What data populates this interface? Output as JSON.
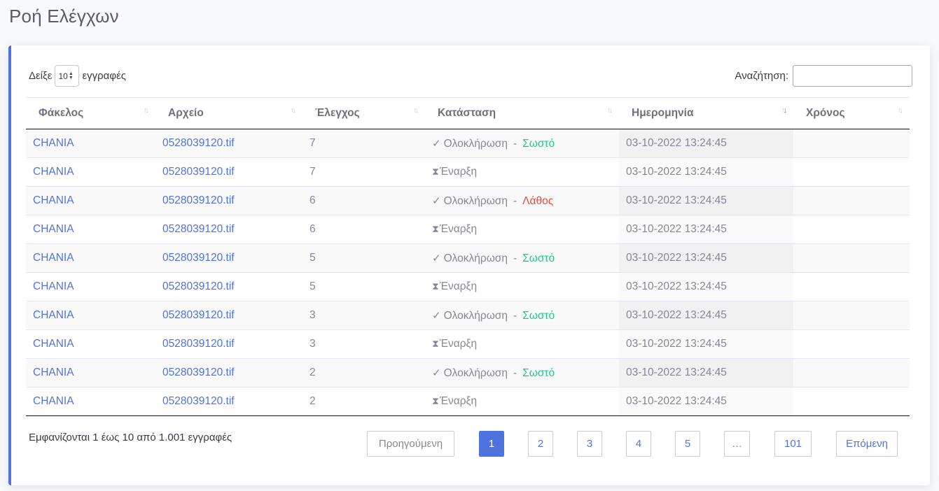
{
  "page": {
    "title": "Ροή Ελέγχων"
  },
  "length": {
    "prefix": "Δείξε",
    "value": "10",
    "suffix": "εγγραφές"
  },
  "search": {
    "label": "Αναζήτηση:",
    "value": ""
  },
  "table": {
    "columns": [
      "Φάκελος",
      "Αρχείο",
      "Έλεγχος",
      "Κατάσταση",
      "Ημερομηνία",
      "Χρόνος"
    ],
    "sorted_column": "Ημερομηνία",
    "rows": [
      {
        "folder": "CHANIA",
        "file": "0528039120.tif",
        "check": "7",
        "status": "Ολοκλήρωση",
        "result": "Σωστό",
        "result_type": "ok",
        "date": "03-10-2022 13:24:45",
        "time": ""
      },
      {
        "folder": "CHANIA",
        "file": "0528039120.tif",
        "check": "7",
        "status": "Έναρξη",
        "result": "",
        "result_type": "",
        "date": "03-10-2022 13:24:45",
        "time": ""
      },
      {
        "folder": "CHANIA",
        "file": "0528039120.tif",
        "check": "6",
        "status": "Ολοκλήρωση",
        "result": "Λάθος",
        "result_type": "err",
        "date": "03-10-2022 13:24:45",
        "time": ""
      },
      {
        "folder": "CHANIA",
        "file": "0528039120.tif",
        "check": "6",
        "status": "Έναρξη",
        "result": "",
        "result_type": "",
        "date": "03-10-2022 13:24:45",
        "time": ""
      },
      {
        "folder": "CHANIA",
        "file": "0528039120.tif",
        "check": "5",
        "status": "Ολοκλήρωση",
        "result": "Σωστό",
        "result_type": "ok",
        "date": "03-10-2022 13:24:45",
        "time": ""
      },
      {
        "folder": "CHANIA",
        "file": "0528039120.tif",
        "check": "5",
        "status": "Έναρξη",
        "result": "",
        "result_type": "",
        "date": "03-10-2022 13:24:45",
        "time": ""
      },
      {
        "folder": "CHANIA",
        "file": "0528039120.tif",
        "check": "3",
        "status": "Ολοκλήρωση",
        "result": "Σωστό",
        "result_type": "ok",
        "date": "03-10-2022 13:24:45",
        "time": ""
      },
      {
        "folder": "CHANIA",
        "file": "0528039120.tif",
        "check": "3",
        "status": "Έναρξη",
        "result": "",
        "result_type": "",
        "date": "03-10-2022 13:24:45",
        "time": ""
      },
      {
        "folder": "CHANIA",
        "file": "0528039120.tif",
        "check": "2",
        "status": "Ολοκλήρωση",
        "result": "Σωστό",
        "result_type": "ok",
        "date": "03-10-2022 13:24:45",
        "time": ""
      },
      {
        "folder": "CHANIA",
        "file": "0528039120.tif",
        "check": "2",
        "status": "Έναρξη",
        "result": "",
        "result_type": "",
        "date": "03-10-2022 13:24:45",
        "time": ""
      }
    ]
  },
  "info": "Εμφανίζονται 1 έως 10 από 1.001 εγγραφές",
  "pagination": {
    "previous": "Προηγούμενη",
    "pages": [
      "1",
      "2",
      "3",
      "4",
      "5",
      "…",
      "101"
    ],
    "current": "1",
    "next": "Επόμενη"
  },
  "colors": {
    "primary": "#4e73df",
    "success": "#1cc88a",
    "danger": "#e74a3b",
    "text": "#858796"
  }
}
